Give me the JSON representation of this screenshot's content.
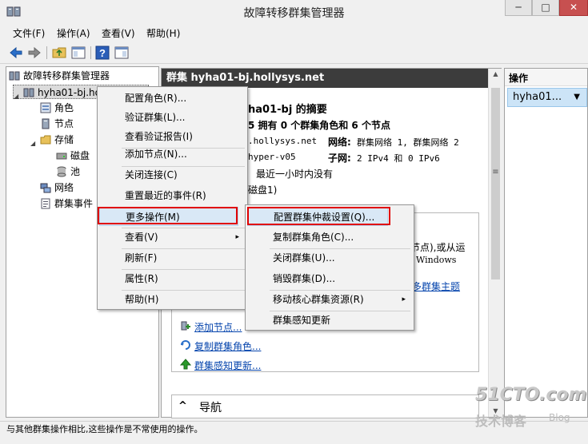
{
  "window": {
    "title": "故障转移群集管理器",
    "min": "─",
    "max": "□",
    "close": "✕"
  },
  "menu": [
    "文件(F)",
    "操作(A)",
    "查看(V)",
    "帮助(H)"
  ],
  "tree": {
    "root": "故障转移群集管理器",
    "cluster": "hyha01-bj.ho",
    "roles": "角色",
    "nodes": "节点",
    "storage": "存储",
    "disks": "磁盘",
    "pools": "池",
    "networks": "网络",
    "events": "群集事件"
  },
  "center": {
    "header": "群集 hyha01-bj.hollysys.net",
    "summary_title": "ha01-bj 的摘要",
    "summary_line1": "5 拥有 0 个群集角色和 6 个节点",
    "host": ".hollysys.net",
    "host2": "hyper-v05",
    "net_label": "网络:",
    "net_value": "群集网络 1, 群集网络 2",
    "subnet_label": "子网:",
    "subnet_value": "2 IPv4 和 0 IPv6",
    "recent": "最近一小时内没有",
    "disk_note": "磁盘1)",
    "box_text1": "节点),或从运",
    "box_text2": "Windows",
    "box_link": "多群集主题",
    "link_add_node": "添加节点...",
    "link_copy_role": "复制群集角色...",
    "link_cau": "群集感知更新...",
    "nav": "导航",
    "nav_chevron": "^"
  },
  "actions": {
    "header": "操作",
    "selected": "hyha01...",
    "selected_arrow": "▼"
  },
  "context_menu": {
    "items": [
      "配置角色(R)...",
      "验证群集(L)...",
      "查看验证报告(I)",
      "添加节点(N)...",
      "关闭连接(C)",
      "重置最近的事件(R)",
      "更多操作(M)",
      "查看(V)",
      "刷新(F)",
      "属性(R)",
      "帮助(H)"
    ],
    "submenu_arrow": "▸"
  },
  "submenu": {
    "items": [
      "配置群集仲裁设置(Q)...",
      "复制群集角色(C)...",
      "关闭群集(U)...",
      "销毁群集(D)...",
      "移动核心群集资源(R)",
      "群集感知更新"
    ]
  },
  "status": "与其他群集操作相比,这些操作是不常使用的操作。",
  "watermark": {
    "line1": "51CTO.com",
    "line2": "技术博客",
    "line3": "Blog"
  },
  "colors": {
    "header_bg": "#3c3c3c",
    "highlight": "#d9e8f6",
    "red_box": "#e00000",
    "link": "#0645ad"
  }
}
